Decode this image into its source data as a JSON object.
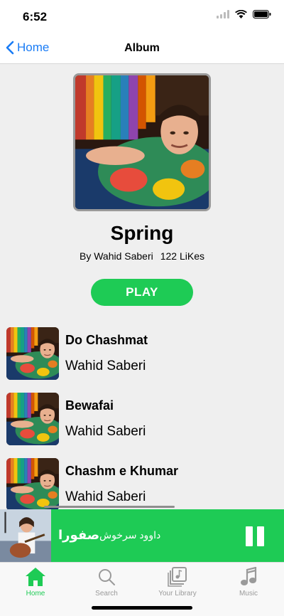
{
  "status_bar": {
    "time": "6:52"
  },
  "nav": {
    "back_label": "Home",
    "title": "Album"
  },
  "album": {
    "title": "Spring",
    "artist_line": "By Wahid Saberi",
    "likes": "122 LiKes",
    "play_label": "PLAY"
  },
  "tracks": [
    {
      "title": "Do Chashmat",
      "artist": "Wahid Saberi"
    },
    {
      "title": "Bewafai",
      "artist": "Wahid Saberi"
    },
    {
      "title": "Chashm e Khumar",
      "artist": "Wahid Saberi"
    }
  ],
  "now_playing": {
    "title": "صفورا",
    "artist": "داوود سرخوش"
  },
  "tabs": [
    {
      "label": "Home",
      "icon": "home-icon",
      "active": true
    },
    {
      "label": "Search",
      "icon": "search-icon",
      "active": false
    },
    {
      "label": "Your Library",
      "icon": "library-icon",
      "active": false
    },
    {
      "label": "Music",
      "icon": "music-note-icon",
      "active": false
    }
  ],
  "colors": {
    "accent": "#1ecb55",
    "link": "#1a7cf5",
    "background": "#efefef"
  }
}
